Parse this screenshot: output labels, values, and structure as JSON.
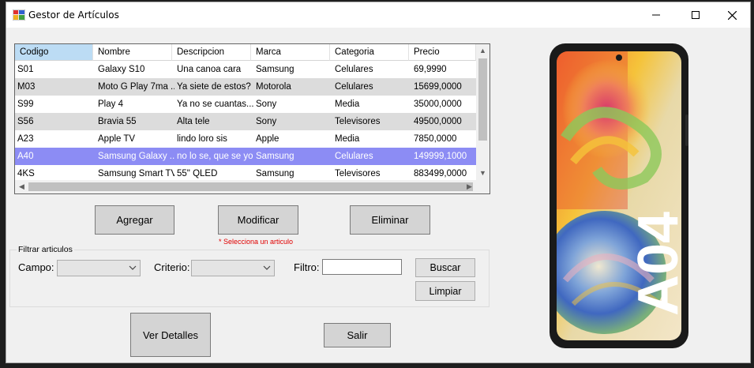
{
  "window": {
    "title": "Gestor de Artículos",
    "controls": [
      "minimize",
      "maximize",
      "close"
    ]
  },
  "grid": {
    "columns": [
      "Codigo",
      "Nombre",
      "Descripcion",
      "Marca",
      "Categoria",
      "Precio"
    ],
    "rows": [
      [
        "S01",
        "Galaxy S10",
        "Una canoa cara",
        "Samsung",
        "Celulares",
        "69,9990"
      ],
      [
        "M03",
        "Moto G Play 7ma ...",
        "Ya siete de estos?",
        "Motorola",
        "Celulares",
        "15699,0000"
      ],
      [
        "S99",
        "Play 4",
        "Ya no se cuantas...",
        "Sony",
        "Media",
        "35000,0000"
      ],
      [
        "S56",
        "Bravia 55",
        "Alta tele",
        "Sony",
        "Televisores",
        "49500,0000"
      ],
      [
        "A23",
        "Apple TV",
        "lindo loro sis",
        "Apple",
        "Media",
        "7850,0000"
      ],
      [
        "A40",
        "Samsung Galaxy ...",
        "no lo se, que se yo",
        "Samsung",
        "Celulares",
        "149999,1000"
      ],
      [
        "4KS",
        "Samsung Smart TV",
        "55\" QLED",
        "Samsung",
        "Televisores",
        "883499,0000"
      ]
    ],
    "selected_row_index": 5
  },
  "actions": {
    "agregar": "Agregar",
    "modificar": "Modificar",
    "eliminar": "Eliminar",
    "hint": "* Selecciona un articulo"
  },
  "filter": {
    "group_label": "Filtrar articulos",
    "campo_label": "Campo:",
    "campo_value": "",
    "criterio_label": "Criterio:",
    "criterio_value": "",
    "filtro_label": "Filtro:",
    "filtro_value": "",
    "buscar": "Buscar",
    "limpiar": "Limpiar"
  },
  "footer": {
    "ver_detalles": "Ver Detalles",
    "salir": "Salir"
  },
  "preview": {
    "model_text": "A04"
  },
  "colors": {
    "selected_row": "#8c8cf4",
    "header_selected": "#bcdcf4",
    "alt_row": "#dcdcdc",
    "hint": "#e00000"
  }
}
